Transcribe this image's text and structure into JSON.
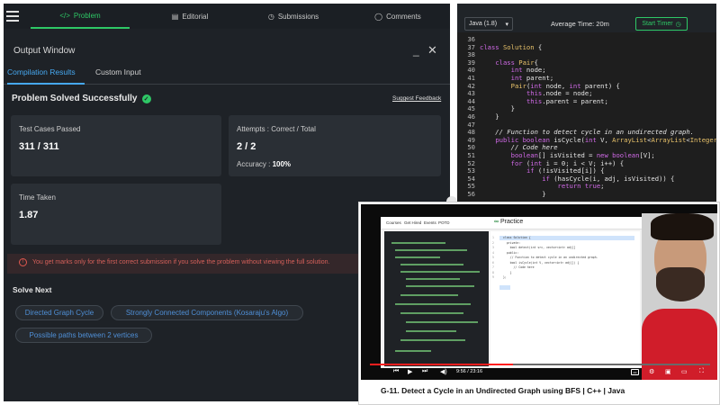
{
  "nav": {
    "tabs": [
      {
        "label": "Problem",
        "icon": "code-icon",
        "active": true
      },
      {
        "label": "Editorial",
        "icon": "document-icon",
        "active": false
      },
      {
        "label": "Submissions",
        "icon": "clock-icon",
        "active": false
      },
      {
        "label": "Comments",
        "icon": "chat-icon",
        "active": false
      }
    ]
  },
  "output_window": {
    "title": "Output Window",
    "minimize_icon": "minimize-icon",
    "close_icon": "close-icon"
  },
  "subtabs": [
    {
      "label": "Compilation Results",
      "active": true
    },
    {
      "label": "Custom Input",
      "active": false
    }
  ],
  "result": {
    "status": "Problem Solved Successfully",
    "feedback_link": "Suggest Feedback"
  },
  "stats": {
    "test_cases_label": "Test Cases Passed",
    "test_cases_value": "311 / 311",
    "attempts_label": "Attempts : Correct / Total",
    "attempts_value": "2 / 2",
    "accuracy_label": "Accuracy :",
    "accuracy_value": "100%",
    "time_label": "Time Taken",
    "time_value": "1.87"
  },
  "alert": {
    "text": "You get marks only for the first correct submission if you solve the problem without viewing the full solution."
  },
  "solve_next": {
    "heading": "Solve Next",
    "items": [
      "Directed Graph Cycle",
      "Strongly Connected Components (Kosaraju's Algo)",
      "Possible paths between 2 vertices"
    ]
  },
  "editor": {
    "language": "Java (1.8)",
    "avg_time": "Average Time: 20m",
    "timer_button": "Start Timer",
    "lines": [
      {
        "n": "36",
        "code": ""
      },
      {
        "n": "37",
        "code": "class Solution {"
      },
      {
        "n": "38",
        "code": ""
      },
      {
        "n": "39",
        "code": "    class Pair{"
      },
      {
        "n": "40",
        "code": "        int node;"
      },
      {
        "n": "41",
        "code": "        int parent;"
      },
      {
        "n": "42",
        "code": "        Pair(int node, int parent) {"
      },
      {
        "n": "43",
        "code": "            this.node = node;"
      },
      {
        "n": "44",
        "code": "            this.parent = parent;"
      },
      {
        "n": "45",
        "code": "        }"
      },
      {
        "n": "46",
        "code": "    }"
      },
      {
        "n": "47",
        "code": ""
      },
      {
        "n": "48",
        "code": "    // Function to detect cycle in an undirected graph."
      },
      {
        "n": "49",
        "code": "    public boolean isCycle(int V, ArrayList<ArrayList<Integer>>"
      },
      {
        "n": "50",
        "code": "        // Code here"
      },
      {
        "n": "51",
        "code": "        boolean[] isVisited = new boolean[V];"
      },
      {
        "n": "52",
        "code": "        for (int i = 0; i < V; i++) {"
      },
      {
        "n": "53",
        "code": "            if (!isVisited[i]) {"
      },
      {
        "n": "54",
        "code": "                if (hasCycle(i, adj, isVisited)) {"
      },
      {
        "n": "55",
        "code": "                    return true;"
      },
      {
        "n": "56",
        "code": "                }"
      }
    ]
  },
  "video": {
    "gfg_nav": [
      "Courses",
      "Get Hired",
      "Events",
      "POTD"
    ],
    "gfg_logo": "Practice",
    "gfg_code": [
      "class Solution {",
      "  private:",
      "    bool detect(int src, vector<int> adj[]",
      "  public:",
      "    // Function to detect cycle in an undirected graph.",
      "    bool isCycle(int V, vector<int> adj[]) {",
      "      // Code here",
      "    }",
      "};"
    ],
    "time": "9:56 / 23:16",
    "progress": 0.42,
    "title": "G-11. Detect a Cycle in an Undirected Graph using BFS | C++ | Java"
  },
  "colors": {
    "accent_green": "#2ec866",
    "link_blue": "#46a8f0",
    "alert_red": "#d5605a",
    "video_red": "#ff1e1e"
  }
}
